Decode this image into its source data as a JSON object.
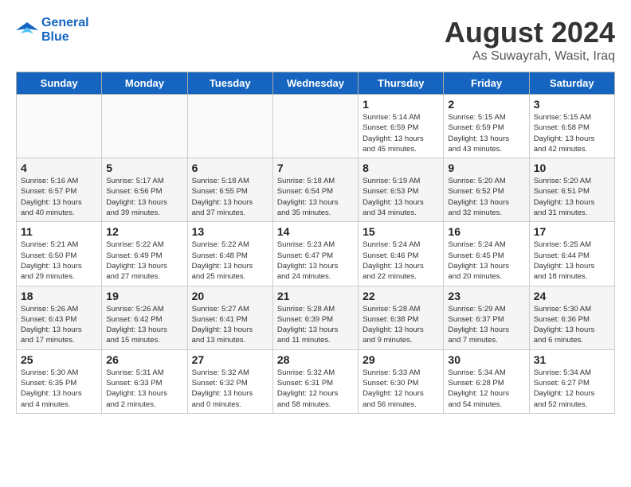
{
  "header": {
    "logo_line1": "General",
    "logo_line2": "Blue",
    "main_title": "August 2024",
    "subtitle": "As Suwayrah, Wasit, Iraq"
  },
  "weekdays": [
    "Sunday",
    "Monday",
    "Tuesday",
    "Wednesday",
    "Thursday",
    "Friday",
    "Saturday"
  ],
  "weeks": [
    [
      {
        "day": "",
        "info": ""
      },
      {
        "day": "",
        "info": ""
      },
      {
        "day": "",
        "info": ""
      },
      {
        "day": "",
        "info": ""
      },
      {
        "day": "1",
        "info": "Sunrise: 5:14 AM\nSunset: 6:59 PM\nDaylight: 13 hours\nand 45 minutes."
      },
      {
        "day": "2",
        "info": "Sunrise: 5:15 AM\nSunset: 6:59 PM\nDaylight: 13 hours\nand 43 minutes."
      },
      {
        "day": "3",
        "info": "Sunrise: 5:15 AM\nSunset: 6:58 PM\nDaylight: 13 hours\nand 42 minutes."
      }
    ],
    [
      {
        "day": "4",
        "info": "Sunrise: 5:16 AM\nSunset: 6:57 PM\nDaylight: 13 hours\nand 40 minutes."
      },
      {
        "day": "5",
        "info": "Sunrise: 5:17 AM\nSunset: 6:56 PM\nDaylight: 13 hours\nand 39 minutes."
      },
      {
        "day": "6",
        "info": "Sunrise: 5:18 AM\nSunset: 6:55 PM\nDaylight: 13 hours\nand 37 minutes."
      },
      {
        "day": "7",
        "info": "Sunrise: 5:18 AM\nSunset: 6:54 PM\nDaylight: 13 hours\nand 35 minutes."
      },
      {
        "day": "8",
        "info": "Sunrise: 5:19 AM\nSunset: 6:53 PM\nDaylight: 13 hours\nand 34 minutes."
      },
      {
        "day": "9",
        "info": "Sunrise: 5:20 AM\nSunset: 6:52 PM\nDaylight: 13 hours\nand 32 minutes."
      },
      {
        "day": "10",
        "info": "Sunrise: 5:20 AM\nSunset: 6:51 PM\nDaylight: 13 hours\nand 31 minutes."
      }
    ],
    [
      {
        "day": "11",
        "info": "Sunrise: 5:21 AM\nSunset: 6:50 PM\nDaylight: 13 hours\nand 29 minutes."
      },
      {
        "day": "12",
        "info": "Sunrise: 5:22 AM\nSunset: 6:49 PM\nDaylight: 13 hours\nand 27 minutes."
      },
      {
        "day": "13",
        "info": "Sunrise: 5:22 AM\nSunset: 6:48 PM\nDaylight: 13 hours\nand 25 minutes."
      },
      {
        "day": "14",
        "info": "Sunrise: 5:23 AM\nSunset: 6:47 PM\nDaylight: 13 hours\nand 24 minutes."
      },
      {
        "day": "15",
        "info": "Sunrise: 5:24 AM\nSunset: 6:46 PM\nDaylight: 13 hours\nand 22 minutes."
      },
      {
        "day": "16",
        "info": "Sunrise: 5:24 AM\nSunset: 6:45 PM\nDaylight: 13 hours\nand 20 minutes."
      },
      {
        "day": "17",
        "info": "Sunrise: 5:25 AM\nSunset: 6:44 PM\nDaylight: 13 hours\nand 18 minutes."
      }
    ],
    [
      {
        "day": "18",
        "info": "Sunrise: 5:26 AM\nSunset: 6:43 PM\nDaylight: 13 hours\nand 17 minutes."
      },
      {
        "day": "19",
        "info": "Sunrise: 5:26 AM\nSunset: 6:42 PM\nDaylight: 13 hours\nand 15 minutes."
      },
      {
        "day": "20",
        "info": "Sunrise: 5:27 AM\nSunset: 6:41 PM\nDaylight: 13 hours\nand 13 minutes."
      },
      {
        "day": "21",
        "info": "Sunrise: 5:28 AM\nSunset: 6:39 PM\nDaylight: 13 hours\nand 11 minutes."
      },
      {
        "day": "22",
        "info": "Sunrise: 5:28 AM\nSunset: 6:38 PM\nDaylight: 13 hours\nand 9 minutes."
      },
      {
        "day": "23",
        "info": "Sunrise: 5:29 AM\nSunset: 6:37 PM\nDaylight: 13 hours\nand 7 minutes."
      },
      {
        "day": "24",
        "info": "Sunrise: 5:30 AM\nSunset: 6:36 PM\nDaylight: 13 hours\nand 6 minutes."
      }
    ],
    [
      {
        "day": "25",
        "info": "Sunrise: 5:30 AM\nSunset: 6:35 PM\nDaylight: 13 hours\nand 4 minutes."
      },
      {
        "day": "26",
        "info": "Sunrise: 5:31 AM\nSunset: 6:33 PM\nDaylight: 13 hours\nand 2 minutes."
      },
      {
        "day": "27",
        "info": "Sunrise: 5:32 AM\nSunset: 6:32 PM\nDaylight: 13 hours\nand 0 minutes."
      },
      {
        "day": "28",
        "info": "Sunrise: 5:32 AM\nSunset: 6:31 PM\nDaylight: 12 hours\nand 58 minutes."
      },
      {
        "day": "29",
        "info": "Sunrise: 5:33 AM\nSunset: 6:30 PM\nDaylight: 12 hours\nand 56 minutes."
      },
      {
        "day": "30",
        "info": "Sunrise: 5:34 AM\nSunset: 6:28 PM\nDaylight: 12 hours\nand 54 minutes."
      },
      {
        "day": "31",
        "info": "Sunrise: 5:34 AM\nSunset: 6:27 PM\nDaylight: 12 hours\nand 52 minutes."
      }
    ]
  ]
}
